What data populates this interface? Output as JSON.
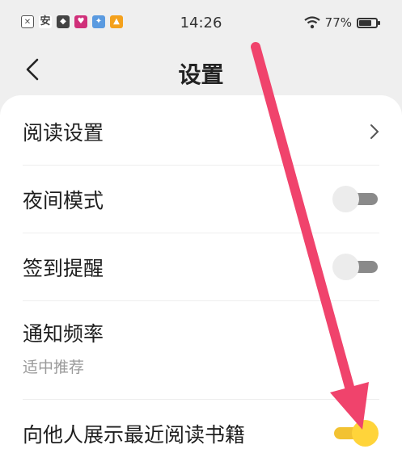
{
  "status": {
    "time": "14:26",
    "battery": "77%",
    "battery_fraction": 0.77,
    "app_icons": [
      "x-icon",
      "an-icon",
      "cat-icon",
      "heart-app-icon",
      "game-app-icon",
      "triangle-app-icon"
    ]
  },
  "nav": {
    "title": "设置"
  },
  "settings": {
    "reading": {
      "label": "阅读设置"
    },
    "night": {
      "label": "夜间模式",
      "on": false
    },
    "checkin": {
      "label": "签到提醒",
      "on": false
    },
    "notify": {
      "label": "通知频率",
      "value": "适中推荐"
    },
    "recent": {
      "label": "向他人展示最近阅读书籍",
      "on": true
    }
  },
  "colors": {
    "accent": "#ffd43a",
    "annotation_arrow": "#f0436c"
  }
}
